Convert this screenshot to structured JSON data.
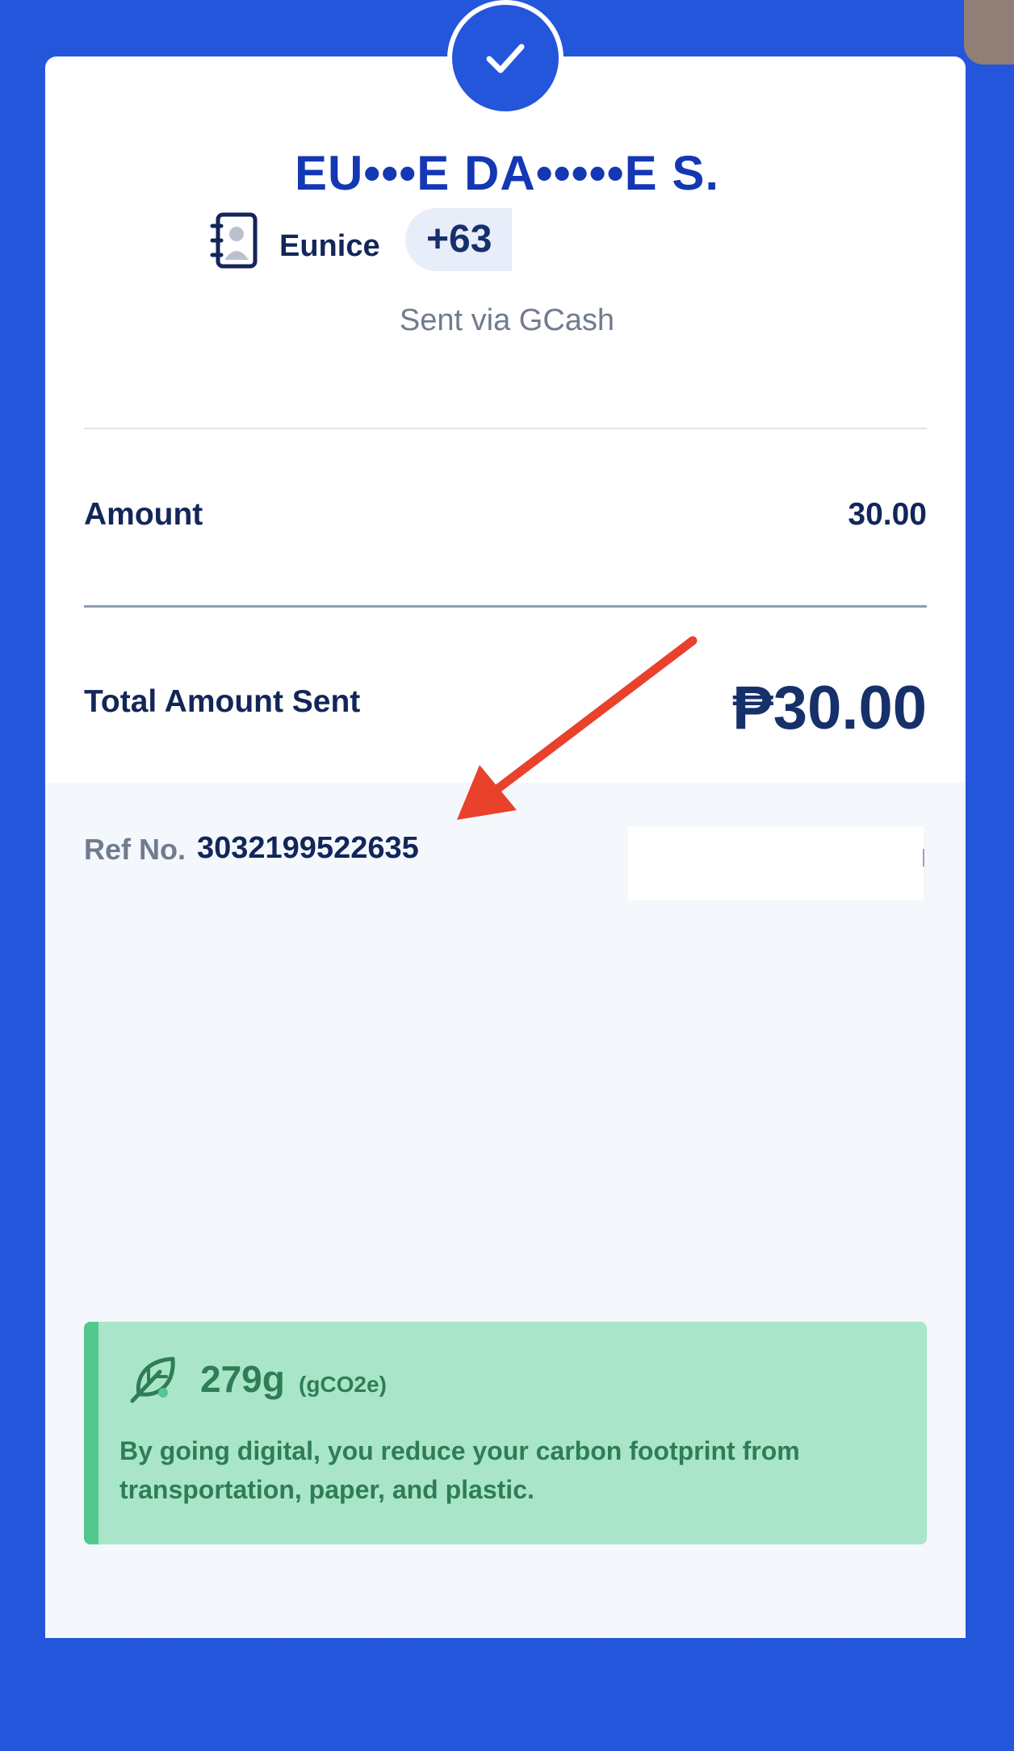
{
  "receipt": {
    "recipient_name": "EU•••E DA•••••E S.",
    "contact_name": "Eunice",
    "phone_prefix": "+63",
    "sent_via": "Sent via GCash",
    "amount_label": "Amount",
    "amount_value": "30.00",
    "total_label": "Total Amount Sent",
    "total_value": "₱30.00",
    "ref_label": "Ref No.",
    "ref_number": "3032199522635"
  },
  "eco": {
    "amount": "279g",
    "unit": "(gCO2e)",
    "message": "By going digital, you reduce your carbon footprint from transportation, paper, and plastic."
  },
  "icons": {
    "status": "check-icon",
    "contact": "contact-book-icon",
    "eco": "leaf-icon"
  },
  "colors": {
    "background": "#2456dc",
    "title": "#1437b3",
    "text_dark": "#13265a",
    "eco_background": "#a9e6c9",
    "eco_accent": "#52c88e",
    "eco_text": "#2f7d55",
    "annotation_arrow": "#e8412c"
  }
}
